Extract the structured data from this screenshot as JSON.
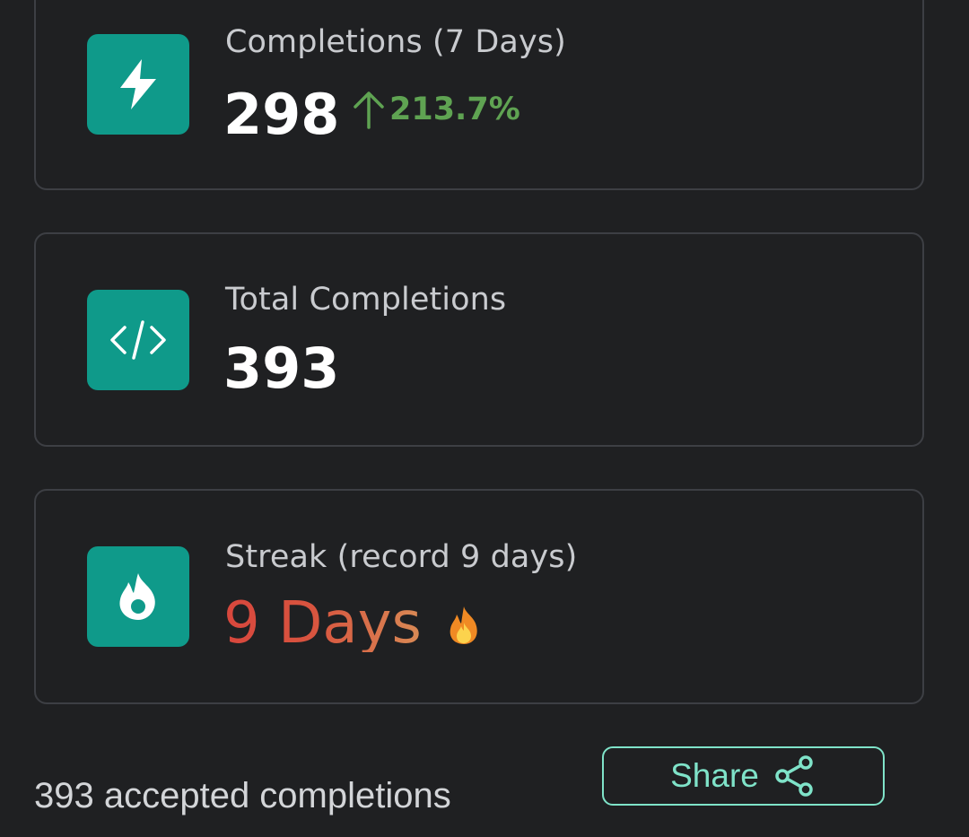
{
  "stats": [
    {
      "icon": "lightning-icon",
      "label": "Completions (7 Days)",
      "value": "298",
      "trend": {
        "direction": "up",
        "text": "213.7%",
        "color": "#5fa352"
      }
    },
    {
      "icon": "code-icon",
      "label": "Total Completions",
      "value": "393"
    },
    {
      "icon": "fire-icon",
      "label": "Streak (record 9 days)",
      "value": "9 Days"
    }
  ],
  "footer": {
    "summary": "393 accepted completions",
    "share_label": "Share",
    "share_icon": "share-icon"
  },
  "colors": {
    "background": "#1f2022",
    "card_border": "#3d3f44",
    "icon_tile": "#0f9a8a",
    "accent": "#7fe3c9",
    "trend_up": "#5fa352",
    "streak": "#d8473d"
  }
}
